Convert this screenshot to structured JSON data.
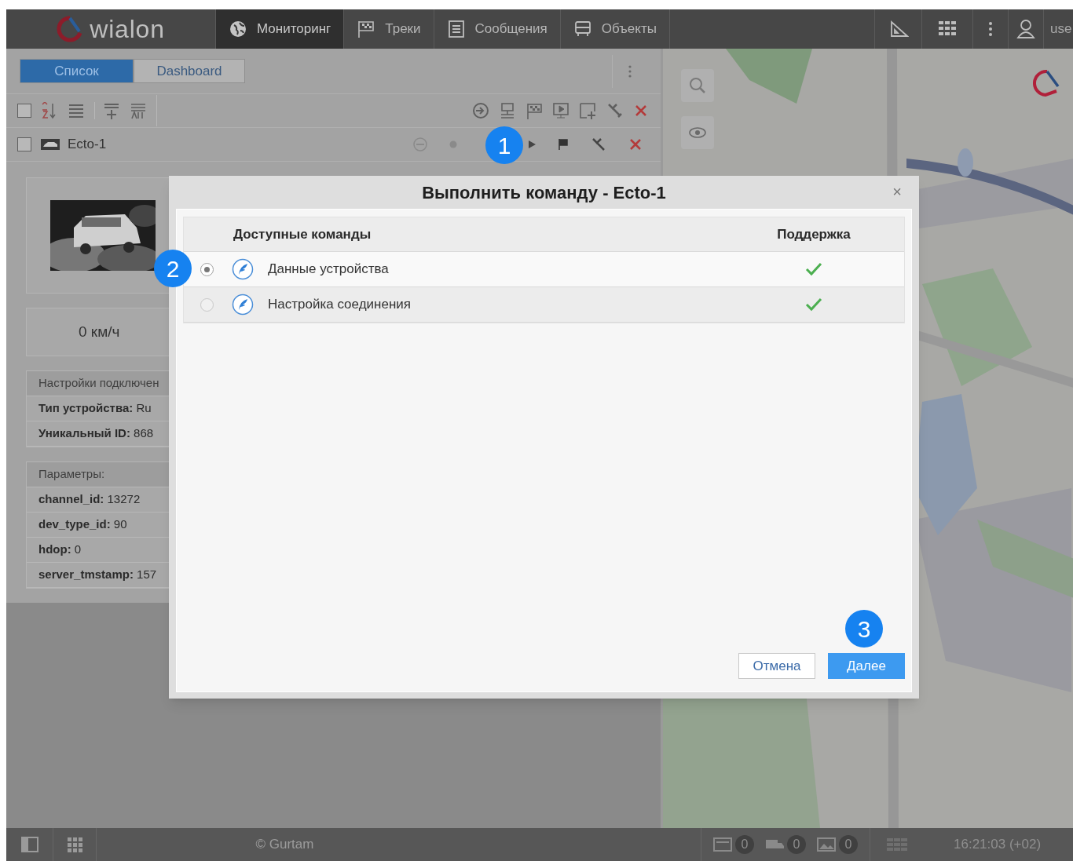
{
  "header": {
    "logo": "wialon",
    "nav": [
      {
        "label": "Мониторинг",
        "selected": true,
        "kind": "globe"
      },
      {
        "label": "Треки",
        "selected": false,
        "kind": "flag"
      },
      {
        "label": "Сообщения",
        "selected": false,
        "kind": "doc"
      },
      {
        "label": "Объекты",
        "selected": false,
        "kind": "bus"
      }
    ],
    "user": "use"
  },
  "panel": {
    "tabs": [
      {
        "label": "Список",
        "selected": true
      },
      {
        "label": "Dashboard",
        "selected": false
      }
    ],
    "select_all_checked": false,
    "units": [
      {
        "name": "Ecto-1",
        "checked": false
      }
    ],
    "speed": "0 км/ч",
    "connection": [
      "Настройки подключен",
      "**Тип устройства:** Ru",
      "**Уникальный ID:** 868"
    ],
    "parameters": [
      "Параметры:",
      "**channel_id:** 13272",
      "**dev_type_id:** 90",
      "**hdop:** 0",
      "**server_tmstamp:** 157"
    ]
  },
  "dialog": {
    "title": "Выполнить команду - Ecto-1",
    "close": "×",
    "columns": [
      "Доступные команды",
      "Поддержка"
    ],
    "commands": [
      {
        "name": "Данные устройства",
        "selected": true,
        "supported": true
      },
      {
        "name": "Настройка соединения",
        "selected": false,
        "supported": true
      }
    ],
    "buttons": [
      {
        "label": "Отмена",
        "kind": "secondary"
      },
      {
        "label": "Далее",
        "kind": "primary"
      }
    ]
  },
  "callouts": [
    "1",
    "2",
    "3"
  ],
  "status_bar": {
    "copyright": "© Gurtam",
    "counters": [
      "0",
      "0",
      "0"
    ],
    "time": "16:21:03 (+02)"
  }
}
